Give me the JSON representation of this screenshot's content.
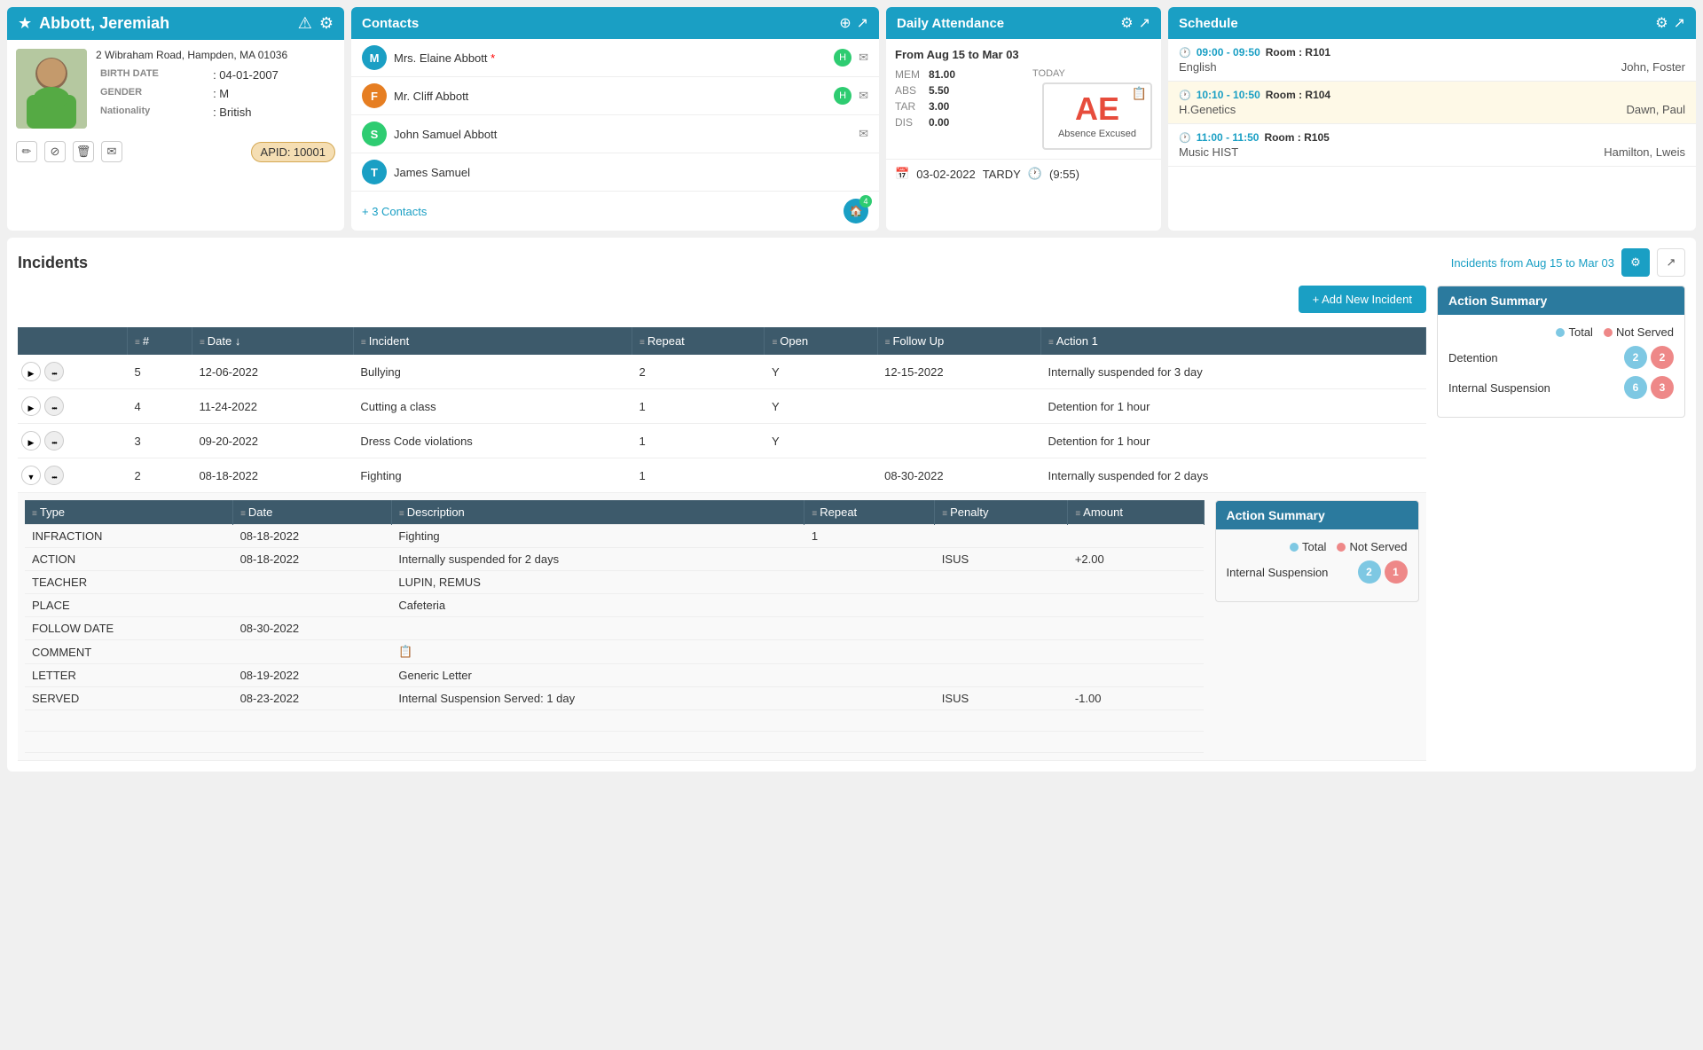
{
  "student": {
    "name": "Abbott, Jeremiah",
    "address": "2 Wibraham Road, Hampden, MA 01036",
    "birth_date_label": "BIRTH DATE",
    "birth_date": ": 04-01-2007",
    "gender_label": "GENDER",
    "gender": ": M",
    "nationality_label": "Nationality",
    "nationality": ": British",
    "apid_label": "APID:",
    "apid_value": "10001"
  },
  "contacts": {
    "title": "Contacts",
    "items": [
      {
        "initial": "M",
        "name": "Mrs. Elaine Abbott",
        "required": true,
        "avatar_class": "avatar-m",
        "has_badge": true
      },
      {
        "initial": "F",
        "name": "Mr. Cliff Abbott",
        "required": false,
        "avatar_class": "avatar-f",
        "has_badge": true
      },
      {
        "initial": "S",
        "name": "John Samuel Abbott",
        "required": false,
        "avatar_class": "avatar-s",
        "has_badge": false
      },
      {
        "initial": "T",
        "name": "James Samuel",
        "required": false,
        "avatar_class": "avatar-t",
        "has_badge": false
      }
    ],
    "more_label": "+ 3 Contacts",
    "more_count": "4"
  },
  "attendance": {
    "title": "Daily Attendance",
    "date_range": "From Aug 15 to Mar 03",
    "stats": [
      {
        "label": "MEM",
        "value": "81.00"
      },
      {
        "label": "ABS",
        "value": "5.50"
      },
      {
        "label": "TAR",
        "value": "3.00"
      },
      {
        "label": "DIS",
        "value": "0.00"
      }
    ],
    "today_label": "TODAY",
    "ae_code": "AE",
    "ae_description": "Absence Excused",
    "footer_date": "03-02-2022",
    "footer_label": "TARDY",
    "footer_time": "(9:55)"
  },
  "schedule": {
    "title": "Schedule",
    "items": [
      {
        "time": "09:00 - 09:50",
        "room": "Room : R101",
        "subject": "English",
        "teacher": "John, Foster",
        "highlighted": false
      },
      {
        "time": "10:10 - 10:50",
        "room": "Room : R104",
        "subject": "H.Genetics",
        "teacher": "Dawn, Paul",
        "highlighted": true
      },
      {
        "time": "11:00 - 11:50",
        "room": "Room : R105",
        "subject": "Music HIST",
        "teacher": "Hamilton, Lweis",
        "highlighted": false
      }
    ]
  },
  "incidents": {
    "title": "Incidents",
    "date_range_label": "Incidents from Aug 15 to Mar 03",
    "add_button": "+ Add New Incident",
    "columns": [
      "",
      "#",
      "Date",
      "Incident",
      "Repeat",
      "Open",
      "Follow Up",
      "Action 1"
    ],
    "rows": [
      {
        "id": 1,
        "num": 5,
        "date": "12-06-2022",
        "incident": "Bullying",
        "repeat": 2,
        "open": "Y",
        "follow_up": "12-15-2022",
        "action1": "Internally suspended for 3 day",
        "expanded": false
      },
      {
        "id": 2,
        "num": 4,
        "date": "11-24-2022",
        "incident": "Cutting a class",
        "repeat": 1,
        "open": "Y",
        "follow_up": "",
        "action1": "Detention for 1 hour",
        "expanded": false
      },
      {
        "id": 3,
        "num": 3,
        "date": "09-20-2022",
        "incident": "Dress Code violations",
        "repeat": 1,
        "open": "Y",
        "follow_up": "",
        "action1": "Detention for 1 hour",
        "expanded": false
      },
      {
        "id": 4,
        "num": 2,
        "date": "08-18-2022",
        "incident": "Fighting",
        "repeat": 1,
        "open": "",
        "follow_up": "08-30-2022",
        "action1": "Internally suspended for 2 days",
        "expanded": true
      }
    ],
    "detail_columns": [
      "Type",
      "Date",
      "Description",
      "Repeat",
      "Penalty",
      "Amount"
    ],
    "detail_rows": [
      {
        "type": "INFRACTION",
        "date": "08-18-2022",
        "description": "Fighting",
        "repeat": "1",
        "penalty": "",
        "amount": ""
      },
      {
        "type": "ACTION",
        "date": "08-18-2022",
        "description": "Internally suspended for 2 days",
        "repeat": "",
        "penalty": "ISUS",
        "amount": "+2.00"
      },
      {
        "type": "TEACHER",
        "date": "",
        "description": "LUPIN, REMUS",
        "repeat": "",
        "penalty": "",
        "amount": ""
      },
      {
        "type": "PLACE",
        "date": "",
        "description": "Cafeteria",
        "repeat": "",
        "penalty": "",
        "amount": ""
      },
      {
        "type": "FOLLOW DATE",
        "date": "08-30-2022",
        "description": "",
        "repeat": "",
        "penalty": "",
        "amount": ""
      },
      {
        "type": "COMMENT",
        "date": "",
        "description": "📋",
        "repeat": "",
        "penalty": "",
        "amount": ""
      },
      {
        "type": "LETTER",
        "date": "08-19-2022",
        "description": "Generic Letter",
        "repeat": "",
        "penalty": "",
        "amount": ""
      },
      {
        "type": "SERVED",
        "date": "08-23-2022",
        "description": "Internal Suspension Served: 1 day",
        "repeat": "",
        "penalty": "ISUS",
        "amount": "-1.00"
      }
    ],
    "action_summary_detail": {
      "title": "Action Summary",
      "legend_total": "Total",
      "legend_not_served": "Not Served",
      "rows": [
        {
          "label": "Internal Suspension",
          "total": 2,
          "not_served": 1
        }
      ]
    }
  },
  "action_summary": {
    "title": "Action Summary",
    "legend_total": "Total",
    "legend_not_served": "Not Served",
    "rows": [
      {
        "label": "Detention",
        "total": 2,
        "not_served": 2
      },
      {
        "label": "Internal Suspension",
        "total": 6,
        "not_served": 3
      }
    ]
  }
}
